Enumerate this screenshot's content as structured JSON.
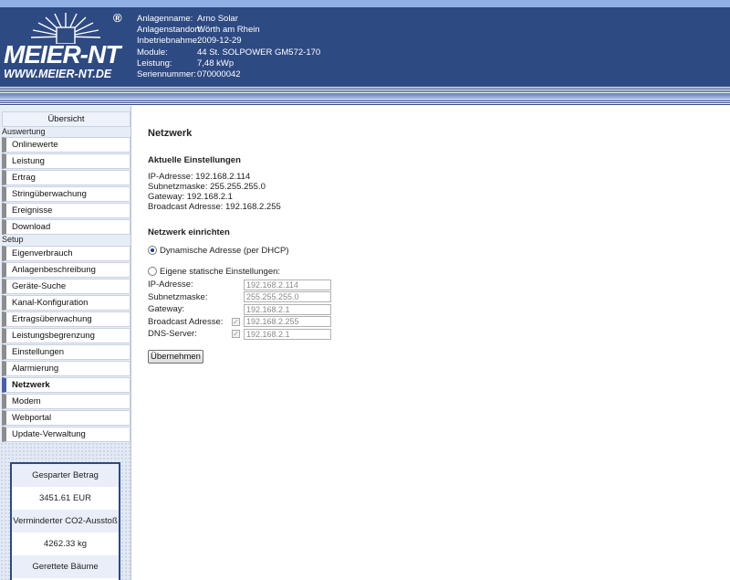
{
  "header": {
    "logo_text": "MEIER-NT",
    "logo_url": "WWW.MEIER-NT.DE",
    "logo_reg": "®",
    "plant": [
      {
        "label": "Anlagenname:",
        "value": "Arno Solar"
      },
      {
        "label": "Anlagenstandort:",
        "value": "Wörth am Rhein"
      },
      {
        "label": "Inbetriebnahme:",
        "value": "2009-12-29"
      },
      {
        "label": "Module:",
        "value": "44 St. SOLPOWER GM572-170"
      },
      {
        "label": "Leistung:",
        "value": "7,48 kWp"
      },
      {
        "label": "Seriennummer:",
        "value": "070000042"
      }
    ]
  },
  "sidebar": {
    "overview": "Übersicht",
    "section_auswertung": "Auswertung",
    "auswertung": [
      "Onlinewerte",
      "Leistung",
      "Ertrag",
      "Stringüberwachung",
      "Ereignisse",
      "Download"
    ],
    "section_setup": "Setup",
    "setup": [
      "Eigenverbrauch",
      "Anlagenbeschreibung",
      "Geräte-Suche",
      "Kanal-Konfiguration",
      "Ertragsüberwachung",
      "Leistungsbegrenzung",
      "Einstellungen",
      "Alarmierung",
      "Netzwerk",
      "Modem",
      "Webportal",
      "Update-Verwaltung"
    ],
    "active": "Netzwerk",
    "stats": [
      {
        "label": "Gesparter Betrag",
        "value": "3451.61 EUR"
      },
      {
        "label": "Verminderter CO2-Ausstoß",
        "value": "4262.33 kg"
      },
      {
        "label": "Gerettete Bäume",
        "value": ""
      }
    ]
  },
  "main": {
    "title": "Netzwerk",
    "current_heading": "Aktuelle Einstellungen",
    "current": [
      "IP-Adresse: 192.168.2.114",
      "Subnetzmaske: 255.255.255.0",
      "Gateway: 192.168.2.1",
      "Broadcast Adresse: 192.168.2.255"
    ],
    "setup_heading": "Netzwerk einrichten",
    "dhcp_label": "Dynamische Adresse (per DHCP)",
    "dhcp_selected": true,
    "static_label": "Eigene statische Einstellungen:",
    "fields": [
      {
        "label": "IP-Adresse:",
        "value": "192.168.2.114",
        "checkbox": false
      },
      {
        "label": "Subnetzmaske:",
        "value": "255.255.255.0",
        "checkbox": false
      },
      {
        "label": "Gateway:",
        "value": "192.168.2.1",
        "checkbox": false
      },
      {
        "label": "Broadcast Adresse:",
        "value": "192.168.2.255",
        "checkbox": true
      },
      {
        "label": "DNS-Server:",
        "value": "192.168.2.1",
        "checkbox": true
      }
    ],
    "submit_label": "Übernehmen"
  },
  "colors": {
    "header_bg": "#2e4a83",
    "sidebar_bg": "#e7edf7",
    "active_bar": "#4a5fa8"
  }
}
